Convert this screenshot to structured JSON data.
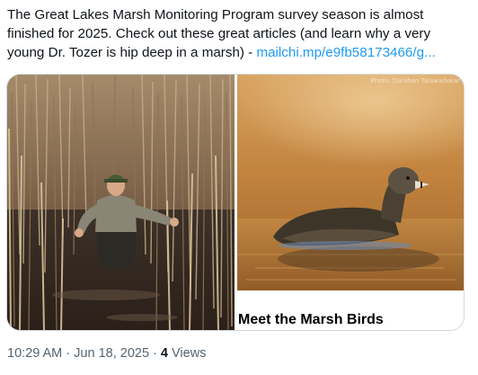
{
  "tweet": {
    "text": "The Great Lakes Marsh Monitoring Program survey season is almost finished for 2025.  Check out these great articles (and learn why a very young Dr. Tozer is hip deep in a marsh) - ",
    "link_text": "mailchi.mp/e9fb58173466/g..."
  },
  "media": {
    "left_image_alt": "Young man standing hip deep in marsh water among reeds",
    "right_image_alt": "Pied-billed grebe swimming on golden water",
    "photo_credit": "Photo: Darshan Talawadekar",
    "caption": "Meet the Marsh Birds"
  },
  "meta": {
    "time": "10:29 AM",
    "sep1": " · ",
    "date": "Jun 18, 2025",
    "sep2": " · ",
    "views_count": "4",
    "views_label": " Views"
  },
  "colors": {
    "link": "#1d9bf0",
    "secondary_text": "#536471",
    "primary_text": "#0f1419",
    "card_border": "#cfd9de"
  }
}
